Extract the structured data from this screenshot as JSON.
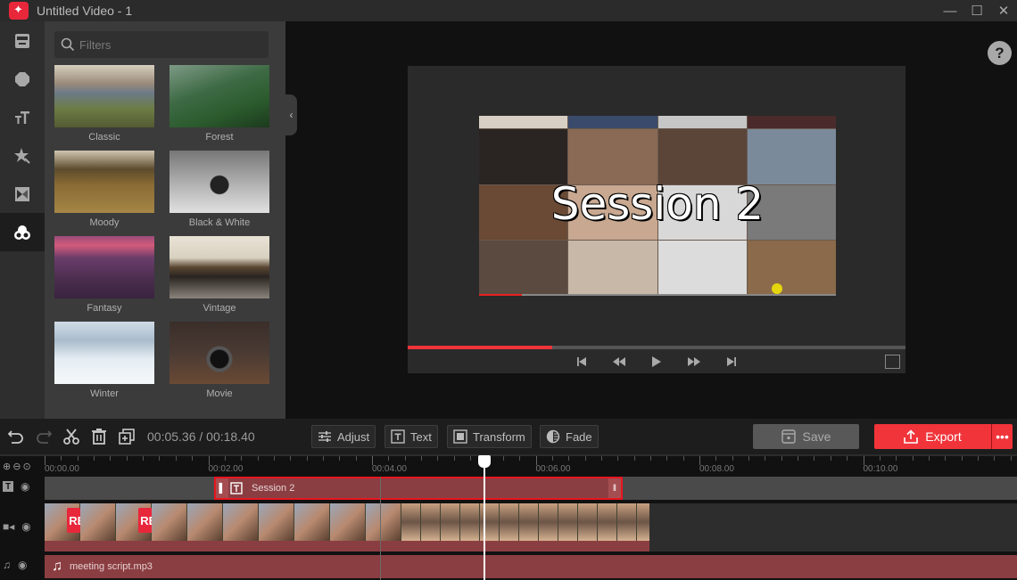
{
  "window": {
    "title": "Untitled Video - 1",
    "controls": {
      "minimize": "—",
      "maximize": "☐",
      "close": "✕"
    }
  },
  "rail": {
    "items": [
      {
        "name": "media",
        "icon": "media-icon"
      },
      {
        "name": "elements",
        "icon": "shape-icon"
      },
      {
        "name": "text",
        "icon": "text-icon"
      },
      {
        "name": "effects",
        "icon": "effects-icon"
      },
      {
        "name": "transitions",
        "icon": "transitions-icon"
      },
      {
        "name": "filters",
        "icon": "filters-icon",
        "active": true
      }
    ]
  },
  "filters_panel": {
    "search_placeholder": "Filters",
    "items": [
      {
        "label": "Classic"
      },
      {
        "label": "Forest"
      },
      {
        "label": "Moody"
      },
      {
        "label": "Black & White"
      },
      {
        "label": "Fantasy"
      },
      {
        "label": "Vintage"
      },
      {
        "label": "Winter"
      },
      {
        "label": "Movie"
      }
    ],
    "collapse_glyph": "‹"
  },
  "preview": {
    "caption": "Session 2",
    "help_glyph": "?",
    "seek_progress_percent": 29,
    "embedded_progress_percent": 12
  },
  "toolbar": {
    "time_display": "00:05.36 / 00:18.40",
    "adjust_label": "Adjust",
    "text_label": "Text",
    "transform_label": "Transform",
    "fade_label": "Fade",
    "save_label": "Save",
    "export_label": "Export",
    "more_glyph": "•••"
  },
  "timeline": {
    "ticks": [
      "00:00.00",
      "00:02.00",
      "00:04.00",
      "00:06.00",
      "00:08.00",
      "00:10.00"
    ],
    "playhead_time": "00:05.36",
    "text_clip_label": "Session 2",
    "audio_clip_label": "meeting script.mp3",
    "rec_badge": "REC"
  },
  "colors": {
    "accent": "#f0343a",
    "clip": "#8b3e42",
    "clip_border": "#e8161f"
  }
}
